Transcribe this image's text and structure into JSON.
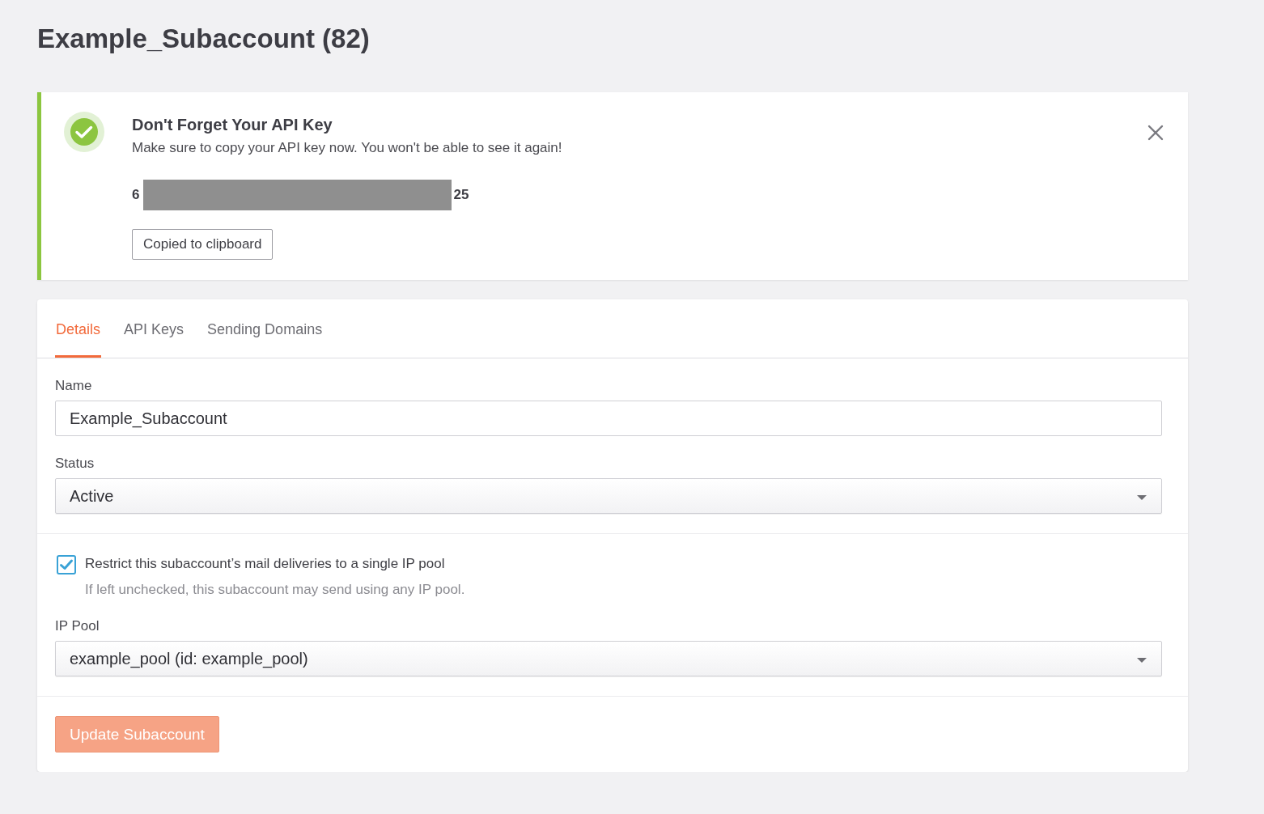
{
  "page_title": "Example_Subaccount (82)",
  "alert": {
    "kind": "success",
    "title": "Don't Forget Your API Key",
    "message": "Make sure to copy your API key now. You won't be able to see it again!",
    "api_key": {
      "start": "6",
      "end": "25",
      "redacted": true
    },
    "button": "Copied to clipboard"
  },
  "tabs": [
    {
      "label": "Details",
      "selected": true
    },
    {
      "label": "API Keys",
      "selected": false
    },
    {
      "label": "Sending Domains",
      "selected": false
    }
  ],
  "form": {
    "sections": [
      {
        "fields": [
          {
            "kind": "text",
            "label": "Name",
            "value": "Example_Subaccount"
          },
          {
            "kind": "select",
            "label": "Status",
            "value": "Active"
          }
        ]
      },
      {
        "fields": [
          {
            "kind": "checkbox",
            "label": "Restrict this subaccount’s mail deliveries to a single IP pool",
            "help": "If left unchecked, this subaccount may send using any IP pool.",
            "checked": true
          },
          {
            "kind": "select",
            "label": "IP Pool",
            "value": "example_pool (id: example_pool)"
          }
        ]
      }
    ]
  },
  "submit_button": {
    "label": "Update Subaccount",
    "disabled": true
  }
}
